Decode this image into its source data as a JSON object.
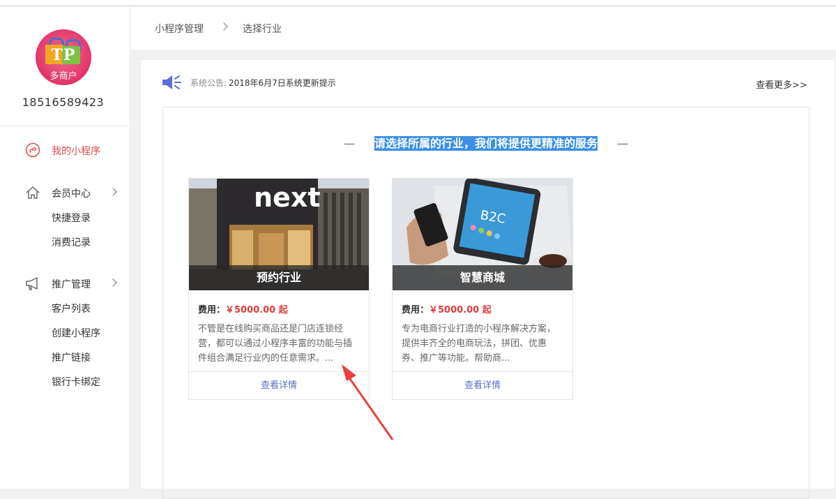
{
  "user": {
    "logo_text": "TP",
    "logo_subtext": "多商户",
    "phone": "18516589423"
  },
  "sidebar": {
    "items": [
      {
        "label": "我的小程序",
        "icon": "mini-program-icon",
        "active": true
      },
      {
        "label": "会员中心",
        "icon": "home-icon",
        "expandable": true,
        "children": [
          {
            "label": "快捷登录"
          },
          {
            "label": "消费记录"
          }
        ]
      },
      {
        "label": "推广管理",
        "icon": "megaphone-icon",
        "expandable": true,
        "children": [
          {
            "label": "客户列表"
          },
          {
            "label": "创建小程序"
          },
          {
            "label": "推广链接"
          },
          {
            "label": "银行卡绑定"
          }
        ]
      }
    ]
  },
  "breadcrumb": {
    "items": [
      "小程序管理",
      "选择行业"
    ]
  },
  "notice": {
    "label": "系统公告:",
    "text": "2018年6月7日系统更新提示",
    "more": "查看更多>>"
  },
  "main": {
    "heading": "请选择所属的行业，我们将提供更精准的服务",
    "dash": "—"
  },
  "cards": [
    {
      "title": "预约行业",
      "fee_label": "费用：",
      "price": "￥5000.00 起",
      "desc": "不管是在线购买商品还是门店连锁经营，都可以通过小程序丰富的功能与插件组合满足行业内的任意需求。...",
      "link": "查看详情",
      "image_text": "next"
    },
    {
      "title": "智慧商城",
      "fee_label": "费用：",
      "price": "￥5000.00 起",
      "desc": "专为电商行业打造的小程序解决方案，提供丰齐全的电商玩法，拼团、优惠券、推广等功能。帮助商...",
      "link": "查看详情",
      "image_text": "B2C"
    }
  ],
  "colors": {
    "accent": "#e24a4a",
    "link": "#5b6fc8",
    "price": "#e03c3c",
    "selection": "#3b8fe4",
    "arrow": "#e8403d"
  }
}
